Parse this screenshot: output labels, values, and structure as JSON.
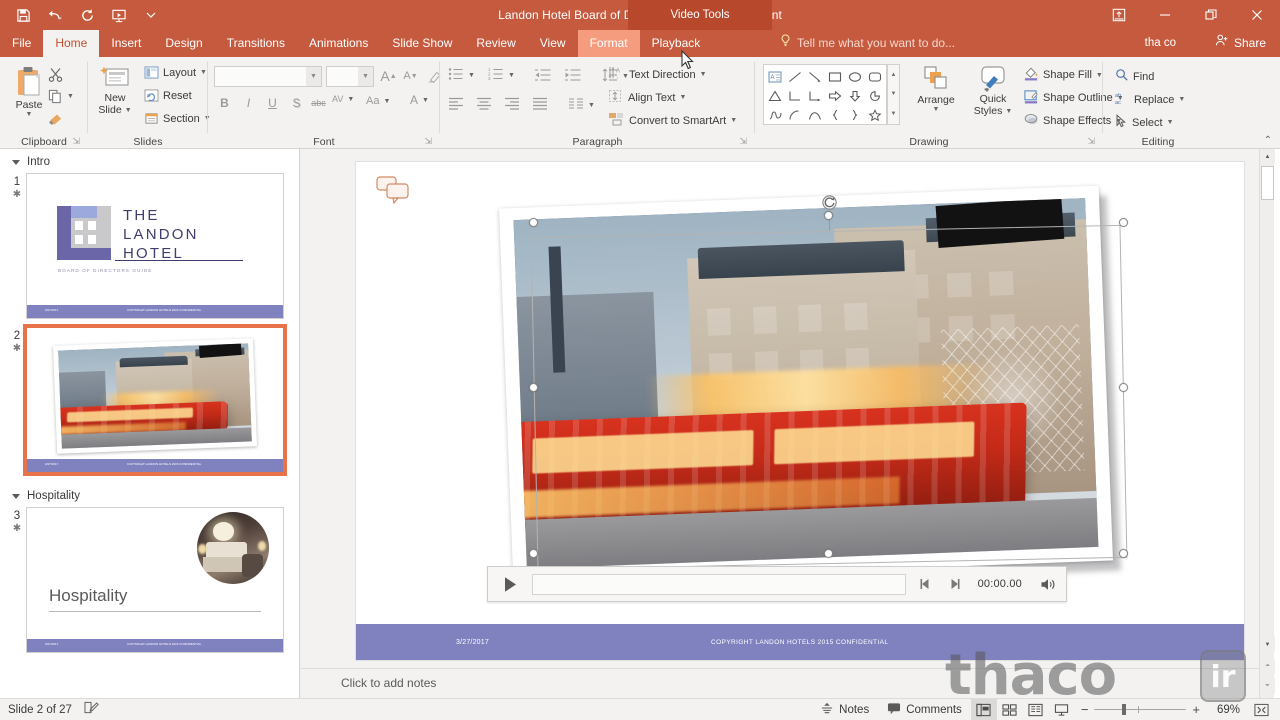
{
  "app": {
    "title": "Landon Hotel Board of Directors Guide - PowerPoint",
    "contextual_group": "Video Tools",
    "account": "tha co",
    "share_label": "Share",
    "tellme_placeholder": "Tell me what you want to do..."
  },
  "quick_access": [
    {
      "name": "save-icon",
      "glyph": "save"
    },
    {
      "name": "undo-icon",
      "glyph": "undo"
    },
    {
      "name": "redo-icon",
      "glyph": "redo"
    },
    {
      "name": "start-slideshow-icon",
      "glyph": "slideshow"
    },
    {
      "name": "customize-qat-icon",
      "glyph": "chevron-down"
    }
  ],
  "window_controls": [
    {
      "name": "ribbon-display-options",
      "glyph": "⤓"
    },
    {
      "name": "minimize",
      "glyph": "–"
    },
    {
      "name": "restore",
      "glyph": "❐"
    },
    {
      "name": "close",
      "glyph": "✕"
    }
  ],
  "tabs": [
    {
      "label": "File",
      "state": "file"
    },
    {
      "label": "Home",
      "state": "active"
    },
    {
      "label": "Insert",
      "state": "normal"
    },
    {
      "label": "Design",
      "state": "normal"
    },
    {
      "label": "Transitions",
      "state": "normal"
    },
    {
      "label": "Animations",
      "state": "normal"
    },
    {
      "label": "Slide Show",
      "state": "normal"
    },
    {
      "label": "Review",
      "state": "normal"
    },
    {
      "label": "View",
      "state": "normal"
    },
    {
      "label": "Format",
      "state": "ctx-active"
    },
    {
      "label": "Playback",
      "state": "ctx"
    }
  ],
  "ribbon": {
    "groups": [
      {
        "label": "Clipboard"
      },
      {
        "label": "Slides"
      },
      {
        "label": "Font"
      },
      {
        "label": "Paragraph"
      },
      {
        "label": "Drawing"
      },
      {
        "label": "Editing"
      }
    ],
    "clipboard": {
      "paste": "Paste",
      "cut": "Cut",
      "copy": "Copy",
      "format_painter": "Format Painter"
    },
    "slides": {
      "new_slide": "New\nSlide",
      "new_slide_line1": "New",
      "new_slide_line2": "Slide",
      "layout": "Layout",
      "reset": "Reset",
      "section": "Section"
    },
    "font": {
      "font_name_value": "",
      "font_size_value": "",
      "increase_size": "A",
      "decrease_size": "A",
      "clear_formatting": "Clear All Formatting",
      "bold": "B",
      "italic": "I",
      "underline": "U",
      "shadow": "S",
      "strikethrough": "abc",
      "character_spacing": "AV",
      "change_case": "Aa",
      "font_color": "A"
    },
    "paragraph": {
      "bullets": "Bullets",
      "numbering": "Numbering",
      "decrease_indent": "Decrease Indent",
      "increase_indent": "Increase Indent",
      "line_spacing": "Line Spacing",
      "align_left": "Align Left",
      "center": "Center",
      "align_right": "Align Right",
      "justify": "Justify",
      "columns": "Columns",
      "text_direction": "Text Direction",
      "align_text": "Align Text",
      "convert_to_smartart": "Convert to SmartArt"
    },
    "drawing": {
      "arrange": "Arrange",
      "quick_styles_line1": "Quick",
      "quick_styles_line2": "Styles",
      "shape_fill": "Shape Fill",
      "shape_outline": "Shape Outline",
      "shape_effects": "Shape Effects"
    },
    "editing": {
      "find": "Find",
      "replace": "Replace",
      "select": "Select"
    },
    "collapse_ribbon": "Collapse the Ribbon"
  },
  "thumbnails": {
    "sections": [
      {
        "name": "Intro",
        "slides": [
          {
            "number": "1",
            "star": "✱"
          }
        ]
      },
      {
        "name": "Hospitality",
        "slides": [
          {
            "number": "3",
            "star": "✱"
          }
        ]
      }
    ],
    "selected_slide_number": "2",
    "selected_slide_star": "✱"
  },
  "slide1": {
    "logo_line1": "THE",
    "logo_line2": "LANDON",
    "logo_line3": "HOTEL",
    "subtitle": "BOARD OF DIRECTORS GUIDE",
    "footer_date": "3/27/2017",
    "footer_copy": "COPYRIGHT LANDON HOTELS 2015 CONFIDENTIAL"
  },
  "slide3": {
    "title": "Hospitality",
    "footer_date": "3/27/2017",
    "footer_copy": "COPYRIGHT LANDON HOTELS 2015 CONFIDENTIAL"
  },
  "slide_canvas": {
    "footer_date": "3/27/2017",
    "footer_copy": "COPYRIGHT LANDON HOTELS 2015 CONFIDENTIAL",
    "comment_marker": "comment-marker"
  },
  "video_controls": {
    "play": "Play",
    "back": "Move Back 0.25 Seconds",
    "forward": "Move Forward 0.25 Seconds",
    "timestamp": "00:00.00",
    "volume": "Mute/Unmute"
  },
  "notes": {
    "placeholder": "Click to add notes"
  },
  "status": {
    "slide_indicator": "Slide 2 of 27",
    "language_icon": "language-icon",
    "notes_label": "Notes",
    "comments_label": "Comments",
    "views": [
      {
        "name": "normal-view",
        "active": true
      },
      {
        "name": "slide-sorter-view",
        "active": false
      },
      {
        "name": "reading-view",
        "active": false
      },
      {
        "name": "slide-show-view",
        "active": false
      }
    ],
    "zoom_out": "−",
    "zoom_in": "+",
    "zoom_level": "69%",
    "fit_to_window": "Fit slide to current window"
  },
  "watermark": {
    "text": "thaco",
    "badge": "ir"
  },
  "colors": {
    "brand_orange": "#c55a3f",
    "contextual_tab": "#f49c7d",
    "ribbon_bg": "#f3f2f1",
    "footer_purple": "#8082c0",
    "logo_purple": "#3f3d6e",
    "selection_orange": "#e8734a"
  }
}
